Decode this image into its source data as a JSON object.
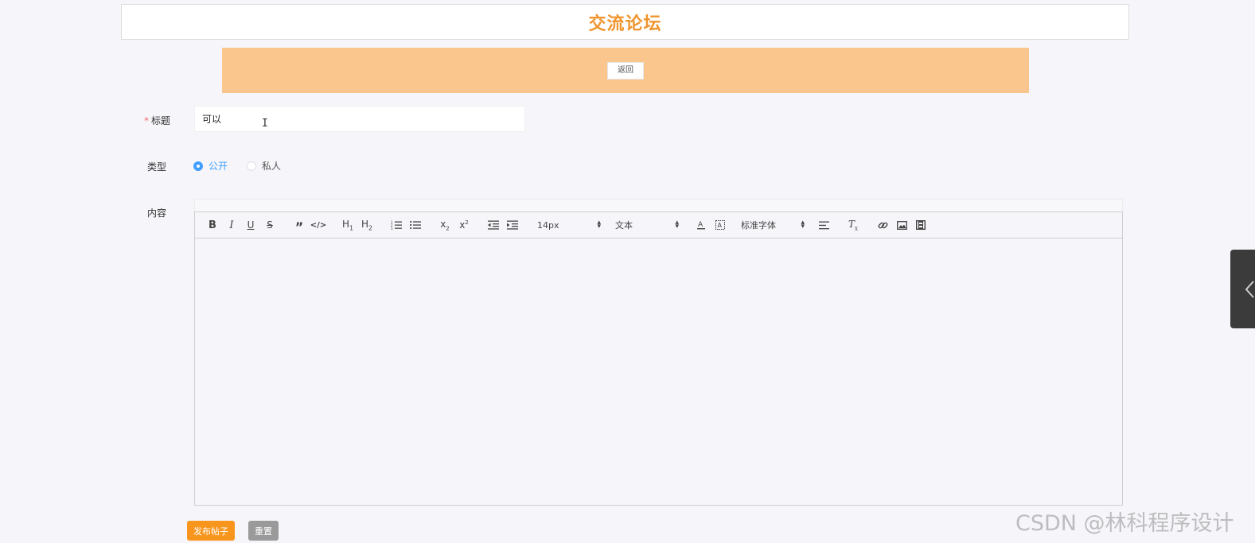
{
  "header": {
    "title": "交流论坛"
  },
  "banner": {
    "back_label": "返回"
  },
  "form": {
    "title_label": "标题",
    "title_required_mark": "*",
    "title_value": "可以",
    "type_label": "类型",
    "type_options": [
      {
        "label": "公开",
        "checked": true
      },
      {
        "label": "私人",
        "checked": false
      }
    ],
    "content_label": "内容"
  },
  "toolbar": {
    "font_size": "14px",
    "header_select": "文本",
    "font_family": "标准字体"
  },
  "actions": {
    "submit_label": "发布帖子",
    "reset_label": "重置"
  },
  "watermark": "CSDN @林科程序设计",
  "colors": {
    "title": "#f0952e",
    "banner": "#fbc68d",
    "accent_blue": "#409eff",
    "primary_button": "#f7951d",
    "reset_button": "#9a9a9a"
  }
}
